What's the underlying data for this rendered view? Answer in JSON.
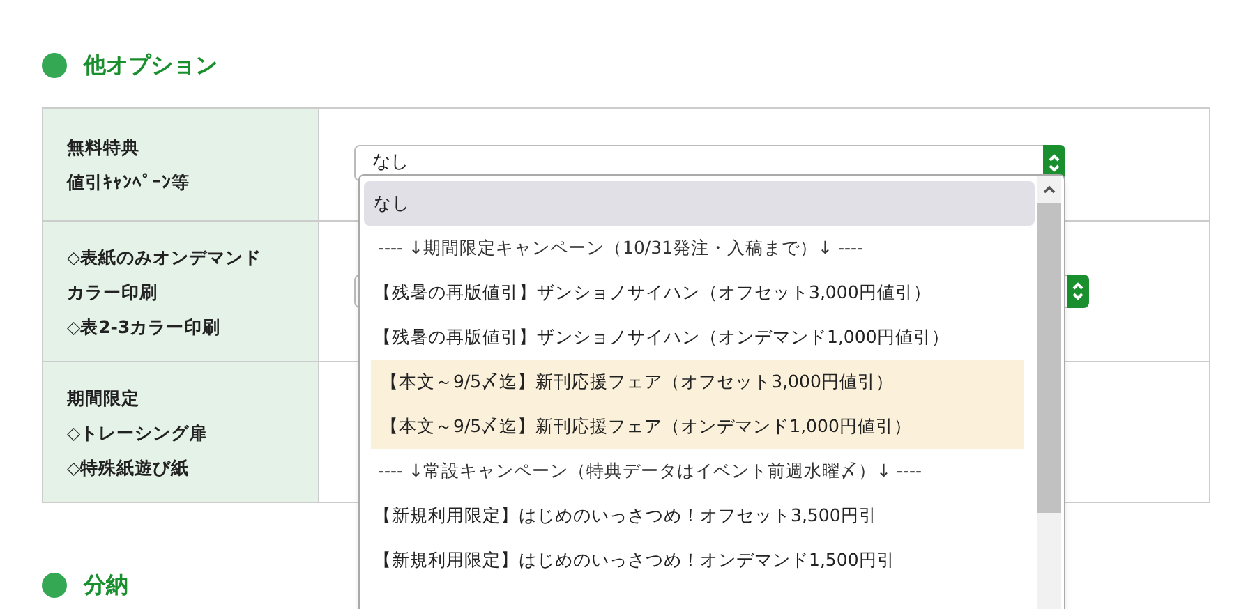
{
  "sections": [
    {
      "title": "他オプション"
    },
    {
      "title": "分納"
    }
  ],
  "rows": [
    {
      "label_lines": [
        "無料特典",
        "値引ｷｬﾝﾍﾟｰﾝ等"
      ],
      "value": "なし"
    },
    {
      "label_lines": [
        "◇表紙のみオンデマンド",
        "カラー印刷",
        "◇表2-3カラー印刷"
      ]
    },
    {
      "label_lines": [
        "期間限定",
        "◇トレーシング扉",
        "◇特殊紙遊び紙"
      ]
    }
  ],
  "dropdown": {
    "options": [
      {
        "label": "なし",
        "kind": "option",
        "selected": true,
        "highlighted": false
      },
      {
        "label": "---- ↓期間限定キャンペーン（10/31発注・入稿まで）↓ ----",
        "kind": "header",
        "selected": false,
        "highlighted": false
      },
      {
        "label": "【残暑の再版値引】ザンショノサイハン（オフセット3,000円値引）",
        "kind": "option",
        "selected": false,
        "highlighted": false
      },
      {
        "label": "【残暑の再版値引】ザンショノサイハン（オンデマンド1,000円値引）",
        "kind": "option",
        "selected": false,
        "highlighted": false
      },
      {
        "label": "【本文～9/5〆迄】新刊応援フェア（オフセット3,000円値引）",
        "kind": "option",
        "selected": false,
        "highlighted": true
      },
      {
        "label": "【本文～9/5〆迄】新刊応援フェア（オンデマンド1,000円値引）",
        "kind": "option",
        "selected": false,
        "highlighted": true
      },
      {
        "label": "---- ↓常設キャンペーン（特典データはイベント前週水曜〆）↓ ----",
        "kind": "header",
        "selected": false,
        "highlighted": false
      },
      {
        "label": "【新規利用限定】はじめのいっさつめ！オフセット3,500円引",
        "kind": "option",
        "selected": false,
        "highlighted": false
      },
      {
        "label": "【新規利用限定】はじめのいっさつめ！オンデマンド1,500円引",
        "kind": "option",
        "selected": false,
        "highlighted": false
      }
    ]
  }
}
